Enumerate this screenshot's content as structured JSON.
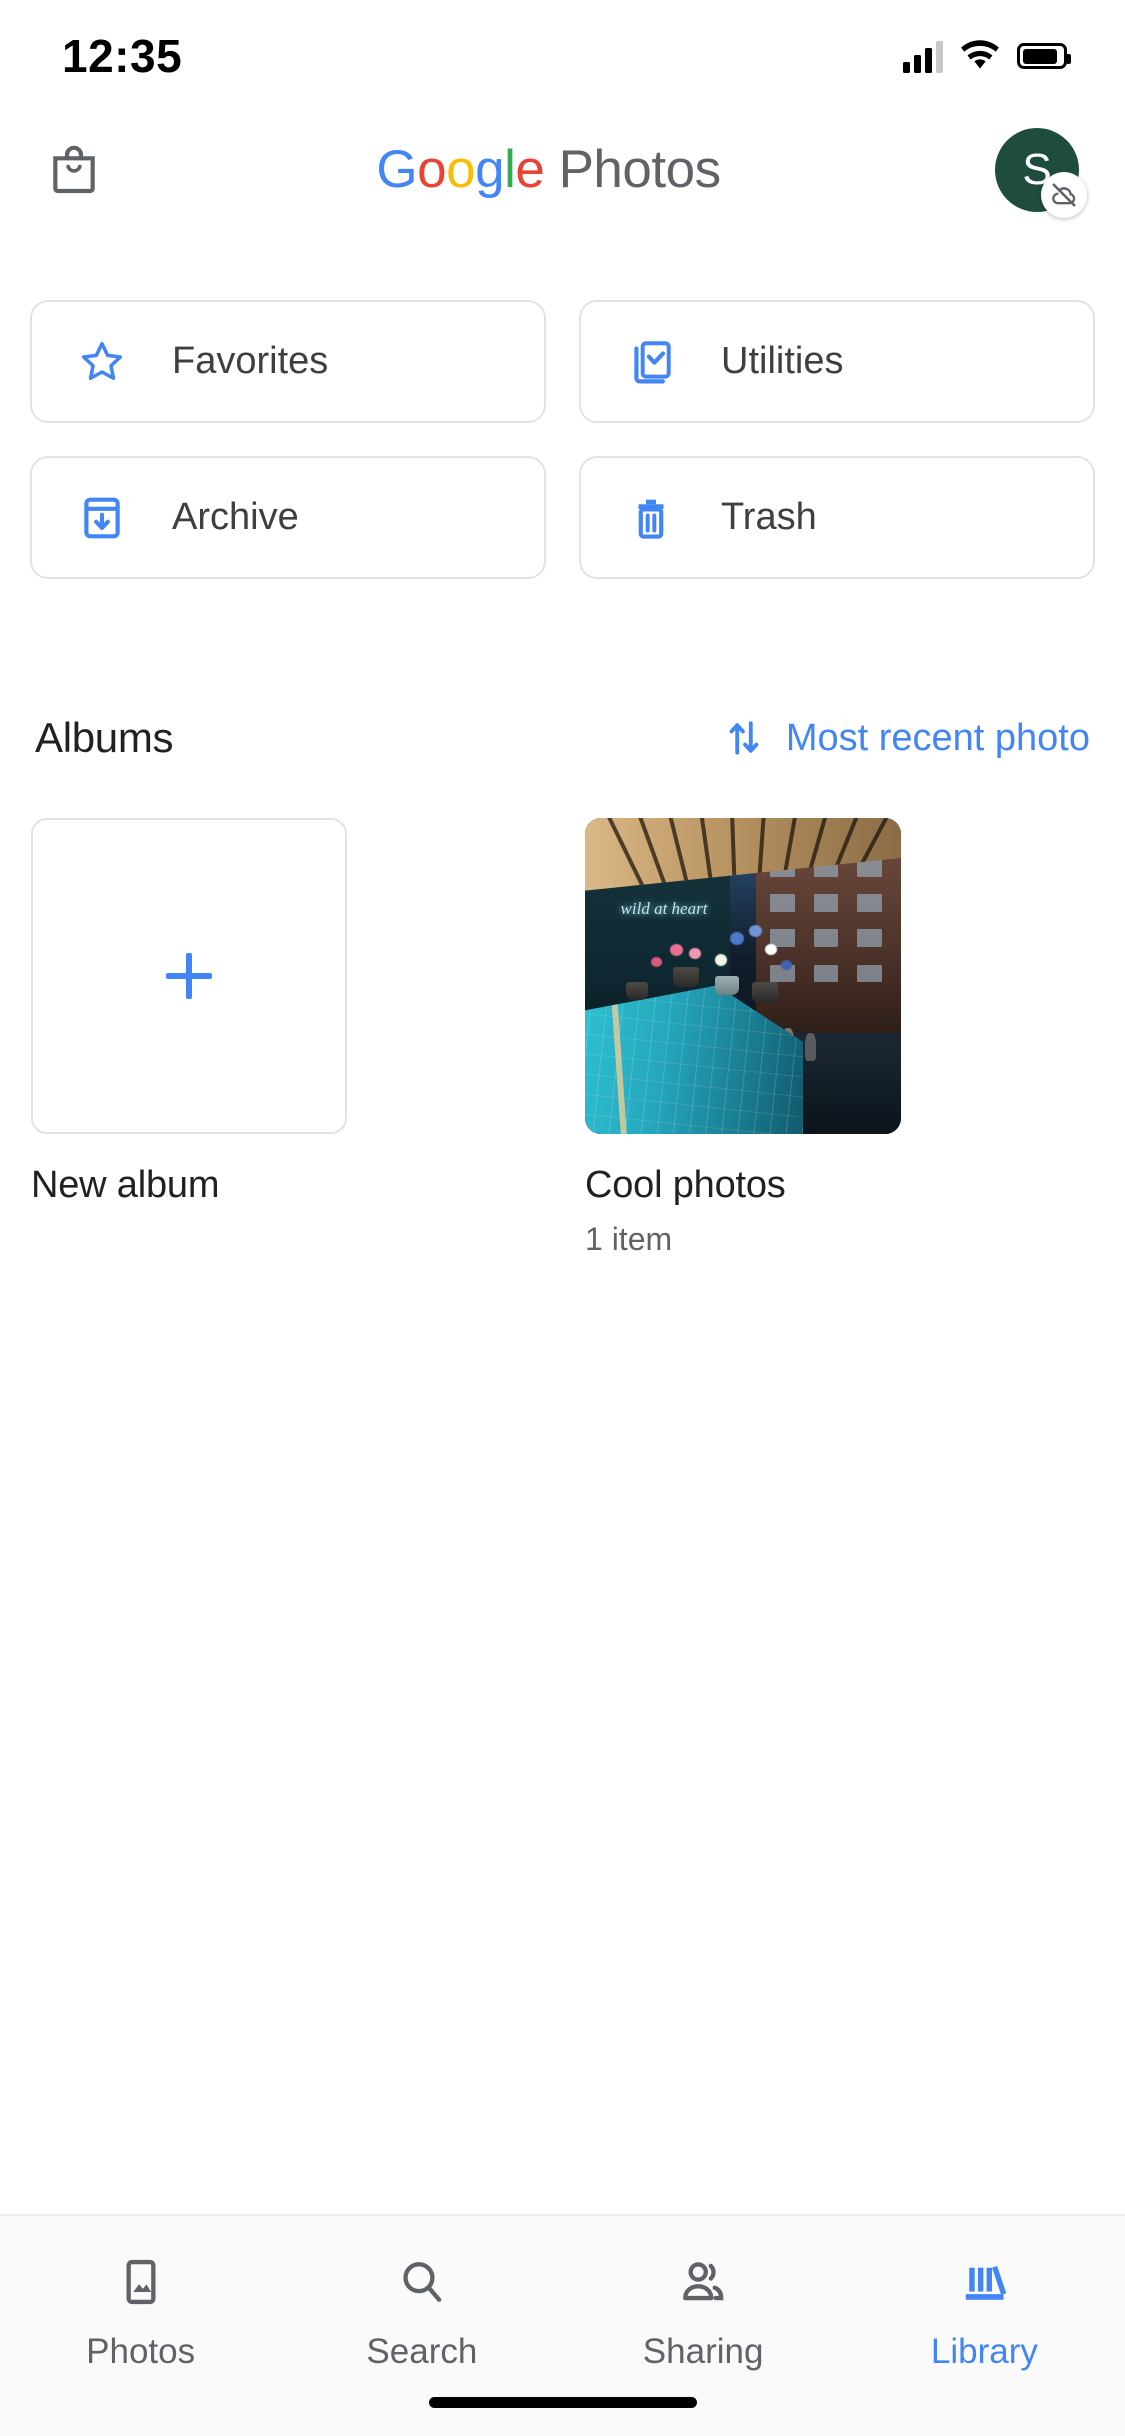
{
  "status_bar": {
    "time": "12:35",
    "signal_icon": "cellular-signal-icon",
    "wifi_icon": "wifi-icon",
    "battery_icon": "battery-icon"
  },
  "header": {
    "store_icon": "shopping-bag-icon",
    "logo": {
      "google": [
        "G",
        "o",
        "o",
        "g",
        "l",
        "e"
      ],
      "photos": "Photos"
    },
    "avatar": {
      "initial": "S",
      "badge_icon": "cloud-off-icon",
      "bg_color": "#1E4D3F"
    }
  },
  "shortcuts": [
    {
      "label": "Favorites",
      "icon": "star-outline-icon"
    },
    {
      "label": "Utilities",
      "icon": "phone-check-icon"
    },
    {
      "label": "Archive",
      "icon": "archive-box-down-arrow-icon"
    },
    {
      "label": "Trash",
      "icon": "trash-can-icon"
    }
  ],
  "albums_section": {
    "title": "Albums",
    "sort": {
      "label": "Most recent photo",
      "icon": "sort-up-down-arrows-icon"
    },
    "items": [
      {
        "type": "new",
        "name": "New album",
        "count": "",
        "icon": "plus-icon"
      },
      {
        "type": "album",
        "name": "Cool photos",
        "count": "1 item",
        "thumbnail_alt": "flower-shop-storefront-photo",
        "neon_sign": "wild at heart"
      }
    ]
  },
  "bottom_nav": {
    "items": [
      {
        "label": "Photos",
        "icon": "photo-frame-icon",
        "active": false
      },
      {
        "label": "Search",
        "icon": "search-icon",
        "active": false
      },
      {
        "label": "Sharing",
        "icon": "people-icon",
        "active": false
      },
      {
        "label": "Library",
        "icon": "library-books-icon",
        "active": true
      }
    ]
  },
  "colors": {
    "accent_blue": "#4285F4",
    "text_primary": "#202124",
    "text_secondary": "#5F6368",
    "border": "#E2E3E5"
  }
}
